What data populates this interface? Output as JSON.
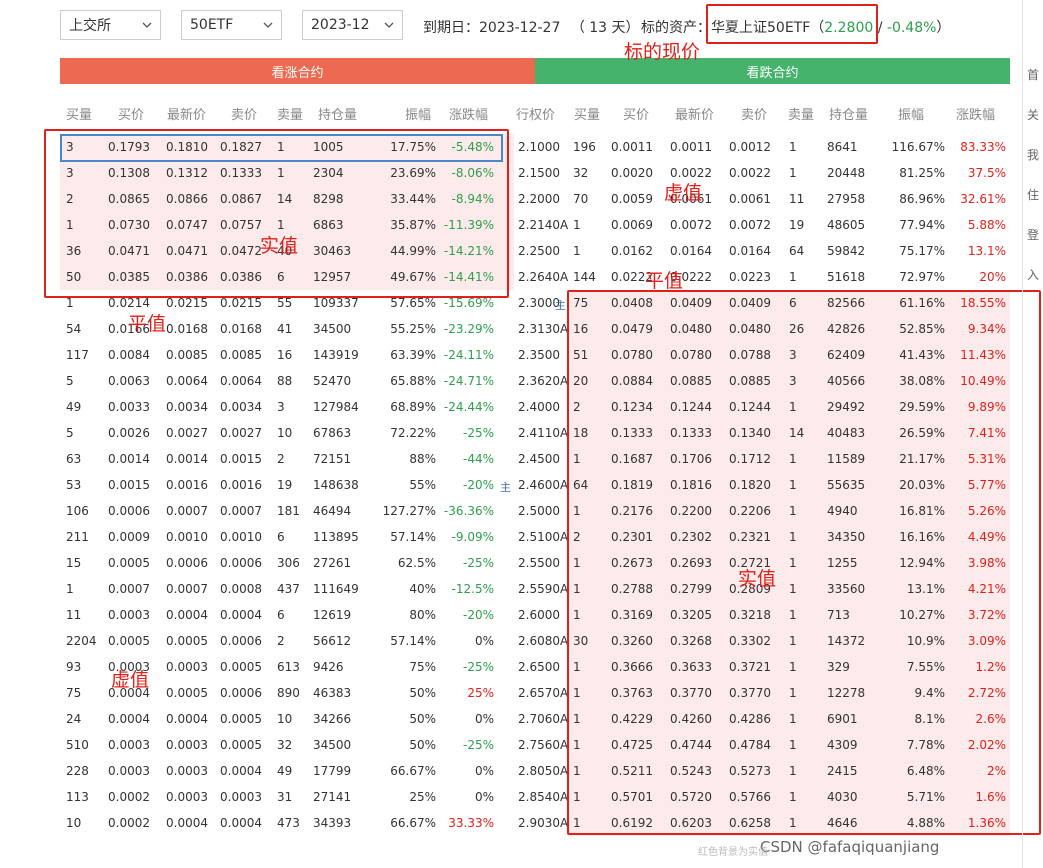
{
  "toolbar": {
    "exchange": "上交所",
    "underlying": "50ETF",
    "month": "2023-12",
    "expiry_label": "到期日：2023-12-27",
    "days_left": "（ 13 天）",
    "asset_label": "标的资产：",
    "asset_name": "华夏上证50ETF",
    "paren_open": "（",
    "price": "2.2800",
    "slash": " / ",
    "change": "-0.48%",
    "paren_close": "）"
  },
  "bars": {
    "call": "看涨合约",
    "put": "看跌合约"
  },
  "call_headers": [
    "买量",
    "买价",
    "最新价",
    "卖价",
    "卖量",
    "持仓量",
    "振幅",
    "涨跌幅"
  ],
  "strike_header": "行权价",
  "put_headers": [
    "买量",
    "买价",
    "最新价",
    "卖价",
    "卖量",
    "持仓量",
    "振幅",
    "涨跌幅"
  ],
  "rows": [
    {
      "c": [
        "3",
        "0.1793",
        "0.1810",
        "0.1827",
        "1",
        "1005",
        "17.75%",
        "-5.48%"
      ],
      "k": "2.1000",
      "p": [
        "196",
        "0.0011",
        "0.0011",
        "0.0012",
        "1",
        "8641",
        "116.67%",
        "83.33%"
      ],
      "cp": true,
      "pp": false
    },
    {
      "c": [
        "3",
        "0.1308",
        "0.1312",
        "0.1333",
        "1",
        "2304",
        "23.69%",
        "-8.06%"
      ],
      "k": "2.1500",
      "p": [
        "32",
        "0.0020",
        "0.0022",
        "0.0022",
        "1",
        "20448",
        "81.25%",
        "37.5%"
      ],
      "cp": true,
      "pp": false
    },
    {
      "c": [
        "2",
        "0.0865",
        "0.0866",
        "0.0867",
        "14",
        "8298",
        "33.44%",
        "-8.94%"
      ],
      "k": "2.2000",
      "p": [
        "70",
        "0.0059",
        "0.0061",
        "0.0061",
        "11",
        "27958",
        "86.96%",
        "32.61%"
      ],
      "cp": true,
      "pp": false
    },
    {
      "c": [
        "1",
        "0.0730",
        "0.0747",
        "0.0757",
        "1",
        "6863",
        "35.87%",
        "-11.39%"
      ],
      "k": "2.2140A",
      "p": [
        "1",
        "0.0069",
        "0.0072",
        "0.0072",
        "19",
        "48605",
        "77.94%",
        "5.88%"
      ],
      "cp": true,
      "pp": false
    },
    {
      "c": [
        "36",
        "0.0471",
        "0.0471",
        "0.0472",
        "40",
        "30463",
        "44.99%",
        "-14.21%"
      ],
      "k": "2.2500",
      "p": [
        "1",
        "0.0162",
        "0.0164",
        "0.0164",
        "64",
        "59842",
        "75.17%",
        "13.1%"
      ],
      "cp": true,
      "pp": false
    },
    {
      "c": [
        "50",
        "0.0385",
        "0.0386",
        "0.0386",
        "6",
        "12957",
        "49.67%",
        "-14.41%"
      ],
      "k": "2.2640A",
      "p": [
        "144",
        "0.0222",
        "0.0222",
        "0.0223",
        "1",
        "51618",
        "72.97%",
        "20%"
      ],
      "cp": true,
      "pp": false
    },
    {
      "c": [
        "1",
        "0.0214",
        "0.0215",
        "0.0215",
        "55",
        "109337",
        "57.65%",
        "-15.69%"
      ],
      "k": "2.3000",
      "p": [
        "75",
        "0.0408",
        "0.0409",
        "0.0409",
        "6",
        "82566",
        "61.16%",
        "18.55%"
      ],
      "cp": false,
      "pp": true
    },
    {
      "c": [
        "54",
        "0.0166",
        "0.0168",
        "0.0168",
        "41",
        "34500",
        "55.25%",
        "-23.29%"
      ],
      "k": "2.3130A",
      "p": [
        "16",
        "0.0479",
        "0.0480",
        "0.0480",
        "26",
        "42826",
        "52.85%",
        "9.34%"
      ],
      "cp": false,
      "pp": true
    },
    {
      "c": [
        "117",
        "0.0084",
        "0.0085",
        "0.0085",
        "16",
        "143919",
        "63.39%",
        "-24.11%"
      ],
      "k": "2.3500",
      "p": [
        "51",
        "0.0780",
        "0.0780",
        "0.0788",
        "3",
        "62409",
        "41.43%",
        "11.43%"
      ],
      "cp": false,
      "pp": true
    },
    {
      "c": [
        "5",
        "0.0063",
        "0.0064",
        "0.0064",
        "88",
        "52470",
        "65.88%",
        "-24.71%"
      ],
      "k": "2.3620A",
      "p": [
        "20",
        "0.0884",
        "0.0885",
        "0.0885",
        "3",
        "40566",
        "38.08%",
        "10.49%"
      ],
      "cp": false,
      "pp": true
    },
    {
      "c": [
        "49",
        "0.0033",
        "0.0034",
        "0.0034",
        "3",
        "127984",
        "68.89%",
        "-24.44%"
      ],
      "k": "2.4000",
      "p": [
        "2",
        "0.1234",
        "0.1244",
        "0.1244",
        "1",
        "29492",
        "29.59%",
        "9.89%"
      ],
      "cp": false,
      "pp": true
    },
    {
      "c": [
        "5",
        "0.0026",
        "0.0027",
        "0.0027",
        "10",
        "67863",
        "72.22%",
        "-25%"
      ],
      "k": "2.4110A",
      "p": [
        "18",
        "0.1333",
        "0.1333",
        "0.1340",
        "14",
        "40483",
        "26.59%",
        "7.41%"
      ],
      "cp": false,
      "pp": true
    },
    {
      "c": [
        "63",
        "0.0014",
        "0.0014",
        "0.0015",
        "2",
        "72151",
        "88%",
        "-44%"
      ],
      "k": "2.4500",
      "p": [
        "1",
        "0.1687",
        "0.1706",
        "0.1712",
        "1",
        "11589",
        "21.17%",
        "5.31%"
      ],
      "cp": false,
      "pp": true
    },
    {
      "c": [
        "53",
        "0.0015",
        "0.0016",
        "0.0016",
        "19",
        "148638",
        "55%",
        "-20%"
      ],
      "k": "2.4600A",
      "p": [
        "64",
        "0.1819",
        "0.1816",
        "0.1820",
        "1",
        "55635",
        "20.03%",
        "5.77%"
      ],
      "cp": false,
      "pp": true
    },
    {
      "c": [
        "106",
        "0.0006",
        "0.0007",
        "0.0007",
        "181",
        "46494",
        "127.27%",
        "-36.36%"
      ],
      "k": "2.5000",
      "p": [
        "1",
        "0.2176",
        "0.2200",
        "0.2206",
        "1",
        "4940",
        "16.81%",
        "5.26%"
      ],
      "cp": false,
      "pp": true
    },
    {
      "c": [
        "211",
        "0.0009",
        "0.0010",
        "0.0010",
        "6",
        "113895",
        "57.14%",
        "-9.09%"
      ],
      "k": "2.5100A",
      "p": [
        "2",
        "0.2301",
        "0.2302",
        "0.2321",
        "1",
        "34350",
        "16.16%",
        "4.49%"
      ],
      "cp": false,
      "pp": true
    },
    {
      "c": [
        "15",
        "0.0005",
        "0.0006",
        "0.0006",
        "306",
        "27261",
        "62.5%",
        "-25%"
      ],
      "k": "2.5500",
      "p": [
        "1",
        "0.2673",
        "0.2693",
        "0.2721",
        "1",
        "1255",
        "12.94%",
        "3.98%"
      ],
      "cp": false,
      "pp": true
    },
    {
      "c": [
        "1",
        "0.0007",
        "0.0007",
        "0.0008",
        "437",
        "111649",
        "40%",
        "-12.5%"
      ],
      "k": "2.5590A",
      "p": [
        "1",
        "0.2788",
        "0.2799",
        "0.2809",
        "1",
        "33560",
        "13.1%",
        "4.21%"
      ],
      "cp": false,
      "pp": true
    },
    {
      "c": [
        "11",
        "0.0003",
        "0.0004",
        "0.0004",
        "6",
        "12619",
        "80%",
        "-20%"
      ],
      "k": "2.6000",
      "p": [
        "1",
        "0.3169",
        "0.3205",
        "0.3218",
        "1",
        "713",
        "10.27%",
        "3.72%"
      ],
      "cp": false,
      "pp": true
    },
    {
      "c": [
        "2204",
        "0.0005",
        "0.0005",
        "0.0006",
        "2",
        "56612",
        "57.14%",
        "0%"
      ],
      "k": "2.6080A",
      "p": [
        "30",
        "0.3260",
        "0.3268",
        "0.3302",
        "1",
        "14372",
        "10.9%",
        "3.09%"
      ],
      "cp": false,
      "pp": true
    },
    {
      "c": [
        "93",
        "0.0003",
        "0.0003",
        "0.0005",
        "613",
        "9426",
        "75%",
        "-25%"
      ],
      "k": "2.6500",
      "p": [
        "1",
        "0.3666",
        "0.3633",
        "0.3721",
        "1",
        "329",
        "7.55%",
        "1.2%"
      ],
      "cp": false,
      "pp": true
    },
    {
      "c": [
        "75",
        "0.0004",
        "0.0005",
        "0.0006",
        "890",
        "46383",
        "50%",
        "25%"
      ],
      "k": "2.6570A",
      "p": [
        "1",
        "0.3763",
        "0.3770",
        "0.3770",
        "1",
        "12278",
        "9.4%",
        "2.72%"
      ],
      "cp": false,
      "pp": true
    },
    {
      "c": [
        "24",
        "0.0004",
        "0.0004",
        "0.0005",
        "10",
        "34266",
        "50%",
        "0%"
      ],
      "k": "2.7060A",
      "p": [
        "1",
        "0.4229",
        "0.4260",
        "0.4286",
        "1",
        "6901",
        "8.1%",
        "2.6%"
      ],
      "cp": false,
      "pp": true
    },
    {
      "c": [
        "510",
        "0.0003",
        "0.0003",
        "0.0005",
        "32",
        "34500",
        "50%",
        "-25%"
      ],
      "k": "2.7560A",
      "p": [
        "1",
        "0.4725",
        "0.4744",
        "0.4784",
        "1",
        "4309",
        "7.78%",
        "2.02%"
      ],
      "cp": false,
      "pp": true
    },
    {
      "c": [
        "228",
        "0.0003",
        "0.0003",
        "0.0004",
        "49",
        "17799",
        "66.67%",
        "0%"
      ],
      "k": "2.8050A",
      "p": [
        "1",
        "0.5211",
        "0.5243",
        "0.5273",
        "1",
        "2415",
        "6.48%",
        "2%"
      ],
      "cp": false,
      "pp": true
    },
    {
      "c": [
        "113",
        "0.0002",
        "0.0003",
        "0.0003",
        "31",
        "27141",
        "25%",
        "0%"
      ],
      "k": "2.8540A",
      "p": [
        "1",
        "0.5701",
        "0.5720",
        "0.5766",
        "1",
        "4030",
        "5.71%",
        "1.6%"
      ],
      "cp": false,
      "pp": true
    },
    {
      "c": [
        "10",
        "0.0002",
        "0.0004",
        "0.0004",
        "473",
        "34393",
        "66.67%",
        "33.33%"
      ],
      "k": "2.9030A",
      "p": [
        "1",
        "0.6192",
        "0.6203",
        "0.6258",
        "1",
        "4646",
        "4.88%",
        "1.36%"
      ],
      "cp": false,
      "pp": true
    }
  ],
  "annotations": {
    "spot": "标的现价",
    "itm_call": "实值",
    "atm_call": "平值",
    "otm_call": "虚值",
    "otm_put": "虚值",
    "atm_put": "平值",
    "itm_put": "实值",
    "marker1": "主",
    "marker2": "主"
  },
  "footer": {
    "watermark": "红色背景为实值",
    "credit": "CSDN @fafaqiquanjiang"
  },
  "sidebar": [
    "首",
    "关",
    "我",
    "住",
    "登",
    "入"
  ],
  "colors": {
    "call_bar": "#ec6a52",
    "put_bar": "#45b36b",
    "itm_bg": "#fdeaea",
    "up": "#e0201a",
    "down": "#2e9e4f",
    "annotation": "#e0201a"
  }
}
